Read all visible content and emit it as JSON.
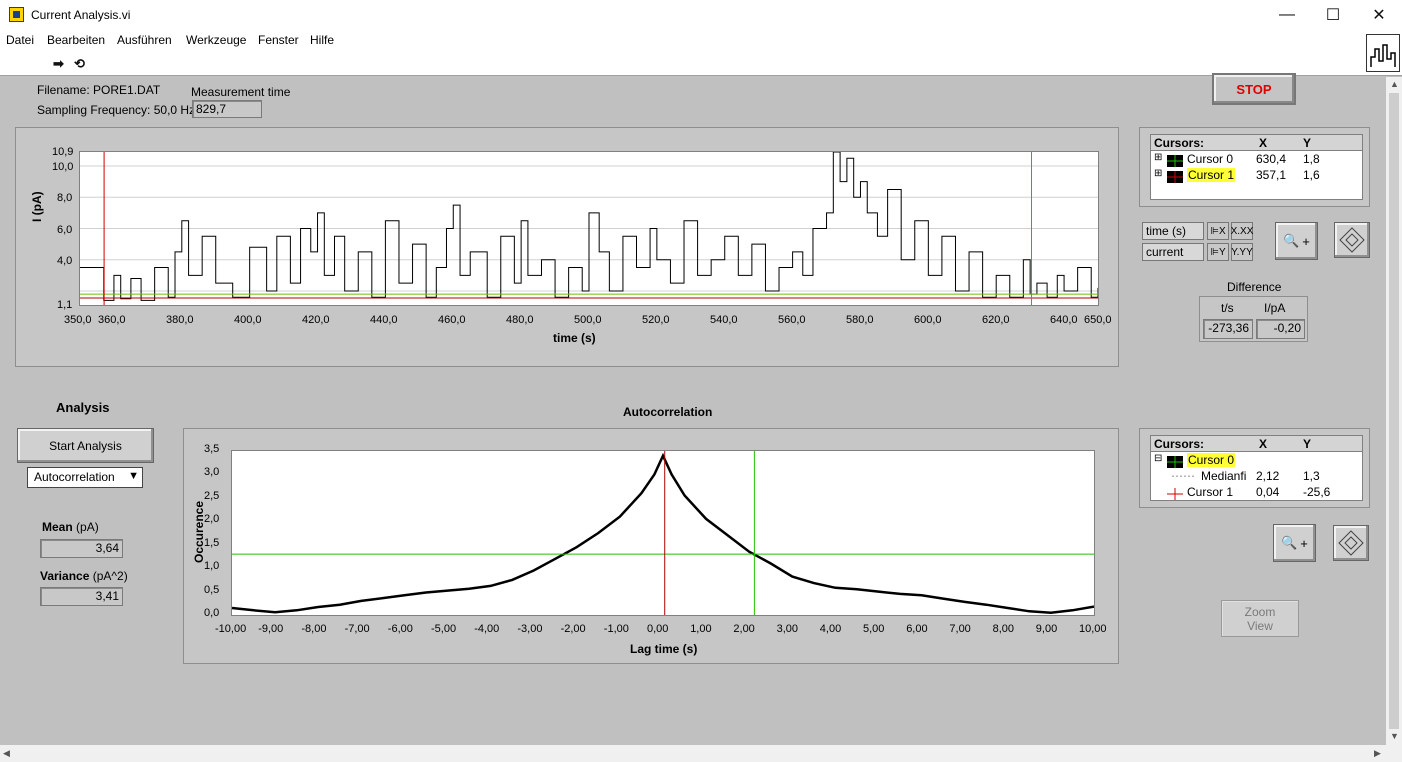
{
  "window": {
    "title": "Current Analysis.vi",
    "minimize": "—",
    "maximize": "☐",
    "close": "✕"
  },
  "menu": [
    "Datei",
    "Bearbeiten",
    "Ausführen",
    "Werkzeuge",
    "Fenster",
    "Hilfe"
  ],
  "toolbar": {
    "run_icon": "run-arrow-icon",
    "run_continuous_icon": "run-continuously-icon",
    "vi_icon": "vi-icon"
  },
  "header": {
    "filename_label": "Filename:",
    "filename": "PORE1.DAT",
    "sampling_label": "Sampling Frequency:",
    "sampling_value": "50,0 Hz",
    "measurement_label": "Measurement time",
    "measurement_value": "829,7"
  },
  "stop_label": "STOP",
  "trace_graph": {
    "ylabel": "I (pA)",
    "xlabel": "time (s)",
    "y_ticks": [
      "10,9",
      "10,0",
      "8,0",
      "6,0",
      "4,0",
      "1,1"
    ],
    "x_ticks": [
      "350,0",
      "360,0",
      "380,0",
      "400,0",
      "420,0",
      "440,0",
      "460,0",
      "480,0",
      "500,0",
      "520,0",
      "540,0",
      "560,0",
      "580,0",
      "600,0",
      "620,0",
      "640,0",
      "650,0"
    ]
  },
  "cursor_table_1": {
    "headers": [
      "Cursors:",
      "X",
      "Y"
    ],
    "rows": [
      {
        "name": "Cursor 0",
        "x": "630,4",
        "y": "1,8",
        "highlight": false
      },
      {
        "name": "Cursor 1",
        "x": "357,1",
        "y": "1,6",
        "highlight": true
      }
    ]
  },
  "scale_legend": {
    "x_name": "time (s)",
    "y_name": "current",
    "x_fmt": "X.XX",
    "y_fmt": "Y.YY"
  },
  "difference": {
    "title": "Difference",
    "col1": "t/s",
    "col2": "I/pA",
    "val1": "-273,36",
    "val2": "-0,20"
  },
  "analysis": {
    "title": "Analysis",
    "start_button": "Start Analysis",
    "mode": "Autocorrelation",
    "mean_label": "Mean",
    "mean_unit": "(pA)",
    "mean_value": "3,64",
    "variance_label": "Variance",
    "variance_unit": "(pA^2)",
    "variance_value": "3,41"
  },
  "cursor_table_2": {
    "headers": [
      "Cursors:",
      "X",
      "Y"
    ],
    "rows": [
      {
        "name": "Cursor 0",
        "x": "",
        "y": "",
        "highlight": true
      },
      {
        "name": "Medianfi",
        "x": "2,12",
        "y": "1,3",
        "highlight": false
      },
      {
        "name": "Cursor 1",
        "x": "0,04",
        "y": "-25,6",
        "highlight": false
      }
    ]
  },
  "zoom_view_label_1": "Zoom",
  "zoom_view_label_2": "View",
  "chart_data": [
    {
      "type": "line",
      "xlabel": "time (s)",
      "ylabel": "I (pA)",
      "xlim": [
        350,
        650
      ],
      "ylim": [
        1.1,
        10.9
      ],
      "series": [
        {
          "x": [
            350,
            357,
            360,
            362,
            365,
            368,
            372,
            376,
            378,
            380,
            382,
            386,
            390,
            395,
            400,
            405,
            408,
            412,
            415,
            418,
            420,
            422,
            425,
            428,
            432,
            436,
            440,
            444,
            448,
            452,
            455,
            458,
            460,
            462,
            465,
            470,
            474,
            478,
            480,
            482,
            486,
            490,
            494,
            498,
            500,
            503,
            506,
            510,
            514,
            518,
            520,
            524,
            528,
            532,
            536,
            540,
            544,
            548,
            552,
            556,
            560,
            563,
            566,
            570,
            572,
            574,
            576,
            578,
            580,
            582,
            585,
            588,
            592,
            596,
            600,
            604,
            608,
            612,
            616,
            620,
            624,
            628,
            630,
            632,
            635,
            638,
            640,
            644,
            648,
            650
          ],
          "values": [
            3.5,
            1.4,
            3.0,
            1.5,
            2.8,
            1.4,
            3.5,
            1.6,
            4.5,
            6.5,
            3.0,
            5.5,
            2.5,
            1.6,
            4.8,
            2.0,
            5.5,
            2.5,
            6.0,
            4.5,
            7.0,
            3.0,
            5.5,
            2.0,
            4.5,
            1.6,
            6.5,
            2.5,
            5.0,
            1.6,
            3.5,
            6.0,
            7.5,
            3.0,
            4.5,
            1.6,
            5.5,
            2.5,
            6.5,
            3.0,
            4.0,
            1.6,
            3.5,
            2.0,
            7.0,
            4.5,
            2.0,
            5.5,
            3.5,
            6.0,
            4.0,
            2.5,
            6.5,
            3.0,
            4.0,
            5.5,
            3.0,
            5.0,
            2.0,
            3.5,
            4.5,
            3.0,
            6.0,
            7.0,
            10.9,
            9.0,
            10.5,
            8.0,
            9.0,
            7.0,
            5.5,
            8.5,
            4.0,
            6.5,
            3.0,
            5.5,
            2.0,
            4.5,
            1.6,
            3.0,
            1.6,
            4.0,
            1.8,
            2.5,
            1.6,
            3.0,
            2.0,
            3.5,
            1.6,
            2.2
          ]
        }
      ],
      "cursors": [
        {
          "name": "Cursor 0",
          "x": 630.4,
          "y": 1.8
        },
        {
          "name": "Cursor 1",
          "x": 357.1,
          "y": 1.6
        }
      ]
    },
    {
      "type": "line",
      "title": "Autocorrelation",
      "xlabel": "Lag time (s)",
      "ylabel": "Occurence",
      "xlim": [
        -10,
        10
      ],
      "ylim": [
        0,
        3.5
      ],
      "x_ticks": [
        "-10,00",
        "-9,00",
        "-8,00",
        "-7,00",
        "-6,00",
        "-5,00",
        "-4,00",
        "-3,00",
        "-2,00",
        "-1,00",
        "0,00",
        "1,00",
        "2,00",
        "3,00",
        "4,00",
        "5,00",
        "6,00",
        "7,00",
        "8,00",
        "9,00",
        "10,00"
      ],
      "y_ticks": [
        "3,5",
        "3,0",
        "2,5",
        "2,0",
        "1,5",
        "1,0",
        "0,5",
        "0,0"
      ],
      "series": [
        {
          "x": [
            -10,
            -9.5,
            -9,
            -8.5,
            -8,
            -7.5,
            -7,
            -6.5,
            -6,
            -5.5,
            -5,
            -4.5,
            -4,
            -3.5,
            -3,
            -2.5,
            -2,
            -1.5,
            -1,
            -0.5,
            -0.2,
            0,
            0.2,
            0.5,
            1,
            1.5,
            2,
            2.5,
            3,
            3.5,
            4,
            4.5,
            5,
            5.5,
            6,
            6.5,
            7,
            7.5,
            8,
            8.5,
            9,
            9.5,
            10
          ],
          "values": [
            0.15,
            0.1,
            0.06,
            0.1,
            0.17,
            0.22,
            0.3,
            0.36,
            0.42,
            0.48,
            0.52,
            0.56,
            0.62,
            0.75,
            0.95,
            1.2,
            1.45,
            1.75,
            2.1,
            2.6,
            3.0,
            3.4,
            3.0,
            2.55,
            2.05,
            1.7,
            1.35,
            1.1,
            0.82,
            0.68,
            0.58,
            0.55,
            0.5,
            0.45,
            0.42,
            0.35,
            0.28,
            0.22,
            0.15,
            0.08,
            0.05,
            0.1,
            0.18
          ]
        }
      ],
      "cursors": [
        {
          "name": "Cursor 0",
          "x": 2.12,
          "y": 1.3
        },
        {
          "name": "Cursor 1",
          "x": 0.04,
          "y": -25.6
        }
      ]
    }
  ]
}
